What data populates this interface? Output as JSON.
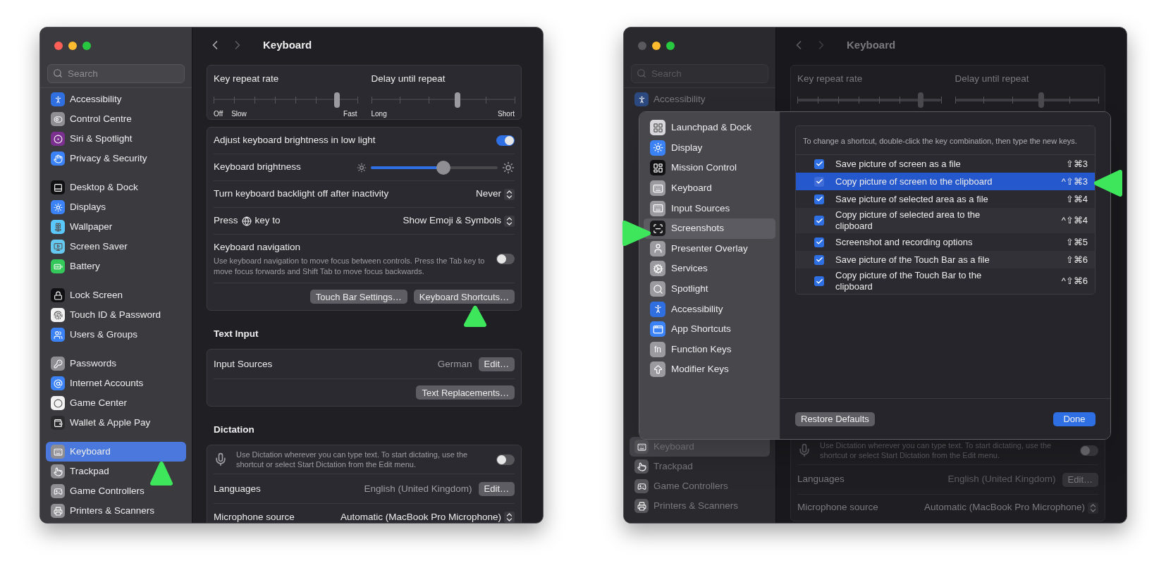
{
  "windows": [
    {
      "active": true,
      "sidebar": {
        "search": {
          "placeholder": "Search"
        },
        "groups": [
          {
            "items": [
              {
                "label": "Accessibility",
                "color": "#2f6fdf",
                "selected": false
              },
              {
                "label": "Control Centre",
                "color": "#8e8e93",
                "selected": false
              },
              {
                "label": "Siri & Spotlight",
                "color": "#7b2f8f",
                "selected": false
              },
              {
                "label": "Privacy & Security",
                "color": "#3a82f6",
                "selected": false
              }
            ]
          },
          {
            "items": [
              {
                "label": "Desktop & Dock",
                "color": "#111114",
                "selected": false
              },
              {
                "label": "Displays",
                "color": "#3a82f6",
                "selected": false
              },
              {
                "label": "Wallpaper",
                "color": "#5ac8fa",
                "selected": false
              },
              {
                "label": "Screen Saver",
                "color": "#64c8f0",
                "selected": false
              },
              {
                "label": "Battery",
                "color": "#34c759",
                "selected": false
              }
            ]
          },
          {
            "items": [
              {
                "label": "Lock Screen",
                "color": "#111114",
                "selected": false
              },
              {
                "label": "Touch ID & Password",
                "color": "#f2f2f2",
                "selected": false
              },
              {
                "label": "Users & Groups",
                "color": "#3a82f6",
                "selected": false
              }
            ]
          },
          {
            "items": [
              {
                "label": "Passwords",
                "color": "#8e8e93",
                "selected": false
              },
              {
                "label": "Internet Accounts",
                "color": "#3a82f6",
                "selected": false
              },
              {
                "label": "Game Center",
                "color": "#f2f2f2",
                "selected": false
              },
              {
                "label": "Wallet & Apple Pay",
                "color": "#2b2b2e",
                "selected": false
              }
            ]
          },
          {
            "items": [
              {
                "label": "Keyboard",
                "color": "#8e8e93",
                "selected": true
              },
              {
                "label": "Trackpad",
                "color": "#8e8e93",
                "selected": false
              },
              {
                "label": "Game Controllers",
                "color": "#8e8e93",
                "selected": false
              },
              {
                "label": "Printers & Scanners",
                "color": "#8e8e93",
                "selected": false
              }
            ]
          }
        ]
      },
      "title": "Keyboard",
      "blocks": [
        {
          "kind": "repeat_card",
          "sliders": [
            {
              "label": "Key repeat rate",
              "level": 0.86,
              "marks": [
                "Off",
                "Slow",
                "Fast"
              ]
            },
            {
              "label": "Delay until repeat",
              "level": 0.6,
              "marks": [
                "Long",
                "Short"
              ]
            }
          ]
        },
        {
          "kind": "card",
          "rows": [
            {
              "kind": "toggle",
              "label": "Adjust keyboard brightness in low light",
              "on": true
            },
            {
              "kind": "slider",
              "label": "Keyboard brightness",
              "level": 0.57
            },
            {
              "kind": "popup",
              "label": "Turn keyboard backlight off after inactivity",
              "value": "Never"
            },
            {
              "kind": "popup",
              "label": "Press",
              "label_after": "key to",
              "value": "Show Emoji & Symbols"
            },
            {
              "kind": "toggle",
              "label": "Keyboard navigation",
              "description": "Use keyboard navigation to move focus between controls. Press the Tab key to move focus forwards and Shift Tab to move focus backwards.",
              "on": false
            },
            {
              "kind": "buttons",
              "buttons": [
                "Touch Bar Settings…",
                "Keyboard Shortcuts…"
              ]
            }
          ]
        },
        {
          "kind": "heading",
          "text": "Text Input"
        },
        {
          "kind": "card",
          "rows": [
            {
              "kind": "value_button",
              "label": "Input Sources",
              "value": "German",
              "button": "Edit…"
            },
            {
              "kind": "buttons",
              "buttons": [
                "Text Replacements…"
              ]
            }
          ]
        },
        {
          "kind": "heading",
          "text": "Dictation"
        },
        {
          "kind": "card",
          "rows": [
            {
              "kind": "mic_toggle",
              "description": "Use Dictation wherever you can type text. To start dictating, use the shortcut or select Start Dictation from the Edit menu.",
              "on": false
            },
            {
              "kind": "value_button",
              "label": "Languages",
              "value": "English (United Kingdom)",
              "button": "Edit…"
            },
            {
              "kind": "popup",
              "label": "Microphone source",
              "value": "Automatic (MacBook Pro Microphone)"
            }
          ]
        }
      ]
    },
    {
      "active": false,
      "sidebar": {
        "search": {
          "placeholder": "Search"
        },
        "groups": [
          {
            "items": [
              {
                "label": "Accessibility",
                "color": "#2c4a80",
                "selected": false
              }
            ]
          }
        ]
      },
      "sidebar_bottom": [
        {
          "items": [
            {
              "label": "Keyboard",
              "color": "#55555a",
              "selected": true
            },
            {
              "label": "Trackpad",
              "color": "#55555a",
              "selected": false
            },
            {
              "label": "Game Controllers",
              "color": "#55555a",
              "selected": false
            },
            {
              "label": "Printers & Scanners",
              "color": "#55555a",
              "selected": false
            }
          ]
        }
      ],
      "title": "Keyboard",
      "blocks": [
        {
          "kind": "repeat_card",
          "sliders": [
            {
              "label": "Key repeat rate",
              "level": 0.86
            },
            {
              "label": "Delay until repeat",
              "level": 0.6
            }
          ]
        }
      ],
      "bottom_blocks": [
        {
          "kind": "card",
          "rows": [
            {
              "kind": "mic_toggle",
              "description": "Use Dictation wherever you can type text. To start dictating, use the shortcut or select Start Dictation from the Edit menu.",
              "on": false
            },
            {
              "kind": "value_button",
              "label": "Languages",
              "value": "English (United Kingdom)",
              "button": "Edit…"
            },
            {
              "kind": "popup",
              "label": "Microphone source",
              "value": "Automatic (MacBook Pro Microphone)"
            }
          ]
        }
      ],
      "sheet": {
        "sidebar": [
          {
            "label": "Launchpad & Dock",
            "color": "#d8d8dc",
            "selected": false
          },
          {
            "label": "Display",
            "color": "#3a82f6",
            "selected": false
          },
          {
            "label": "Mission Control",
            "color": "#111114",
            "selected": false
          },
          {
            "label": "Keyboard",
            "color": "#9a9a9f",
            "selected": false
          },
          {
            "label": "Input Sources",
            "color": "#9a9a9f",
            "selected": false
          },
          {
            "label": "Screenshots",
            "color": "#1c1c1e",
            "selected": true
          },
          {
            "label": "Presenter Overlay",
            "color": "#9a9a9f",
            "selected": false
          },
          {
            "label": "Services",
            "color": "#9a9a9f",
            "selected": false
          },
          {
            "label": "Spotlight",
            "color": "#9a9a9f",
            "selected": false
          },
          {
            "label": "Accessibility",
            "color": "#2f6fdf",
            "selected": false
          },
          {
            "label": "App Shortcuts",
            "color": "#3a82f6",
            "selected": false
          },
          {
            "label": "Function Keys",
            "glyph": "fn",
            "color": "#9a9a9f",
            "selected": false
          },
          {
            "label": "Modifier Keys",
            "color": "#9a9a9f",
            "selected": false
          }
        ],
        "hint": "To change a shortcut, double-click the key combination, then type the new keys.",
        "shortcuts": [
          {
            "label": "Save picture of screen as a file",
            "keys": "⇧⌘3",
            "checked": true,
            "selected": false
          },
          {
            "label": "Copy picture of screen to the clipboard",
            "keys": "^⇧⌘3",
            "checked": true,
            "selected": true
          },
          {
            "label": "Save picture of selected area as a file",
            "keys": "⇧⌘4",
            "checked": true,
            "selected": false
          },
          {
            "label": "Copy picture of selected area to the clipboard",
            "keys": "^⇧⌘4",
            "checked": true,
            "selected": false
          },
          {
            "label": "Screenshot and recording options",
            "keys": "⇧⌘5",
            "checked": true,
            "selected": false
          },
          {
            "label": "Save picture of the Touch Bar as a file",
            "keys": "⇧⌘6",
            "checked": true,
            "selected": false
          },
          {
            "label": "Copy picture of the Touch Bar to the clipboard",
            "keys": "^⇧⌘6",
            "checked": true,
            "selected": false
          }
        ],
        "buttons": [
          {
            "label": "Restore Defaults",
            "kind": "secondary"
          },
          {
            "label": "Done",
            "kind": "primary"
          }
        ]
      }
    }
  ]
}
